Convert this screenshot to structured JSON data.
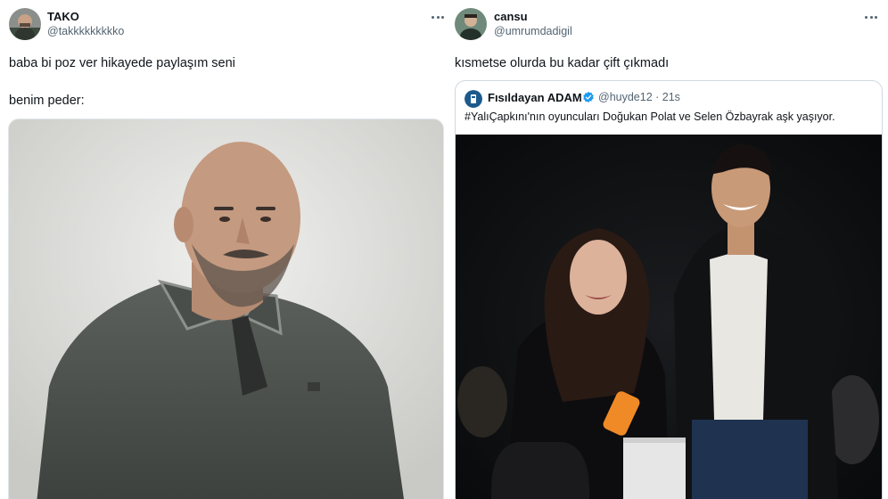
{
  "tweets": [
    {
      "author": {
        "name": "TAKO",
        "handle": "@takkkkkkkkko"
      },
      "text_lines": [
        "baba bi poz ver hikayede paylaşım seni",
        "benim peder:"
      ],
      "media_description": "photo"
    },
    {
      "author": {
        "name": "cansu",
        "handle": "@umrumdadigil"
      },
      "text_lines": [
        "kısmetse olurda bu kadar çift çıkmadı"
      ],
      "quoted": {
        "author": {
          "name": "Fısıldayan ADAM",
          "handle": "@huyde12",
          "time": "21s",
          "verified": true
        },
        "text": "#YalıÇapkını'nın oyuncuları Doğukan Polat ve Selen Özbayrak aşk yaşıyor."
      }
    }
  ],
  "icons": {
    "more": "more-dots-icon",
    "verified": "verified-badge-icon"
  },
  "colors": {
    "text": "#0f1419",
    "secondary": "#536471",
    "verified": "#1d9bf0",
    "border": "#cfd9de"
  }
}
